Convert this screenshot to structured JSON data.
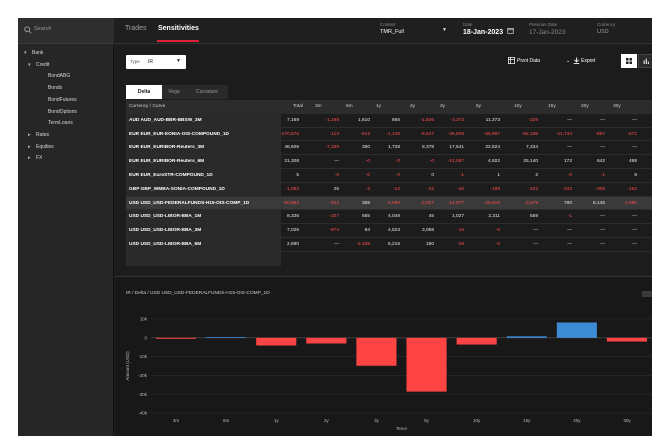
{
  "search": {
    "placeholder": "Search"
  },
  "sidebar": {
    "items": [
      {
        "label": "Bank",
        "arrow": "▾",
        "level": 0
      },
      {
        "label": "Credit",
        "arrow": "▾",
        "level": 1
      },
      {
        "label": "BondABG",
        "arrow": "",
        "level": 2
      },
      {
        "label": "Bonds",
        "arrow": "",
        "level": 2
      },
      {
        "label": "BondFutures",
        "arrow": "",
        "level": 2
      },
      {
        "label": "BondOptions",
        "arrow": "",
        "level": 2
      },
      {
        "label": "TermLoans",
        "arrow": "",
        "level": 2
      },
      {
        "label": "Rates",
        "arrow": "▸",
        "level": 1
      },
      {
        "label": "Equities",
        "arrow": "▸",
        "level": 1
      },
      {
        "label": "FX",
        "arrow": "▸",
        "level": 1
      }
    ]
  },
  "header": {
    "tabs": [
      "Trades",
      "Sensitivities"
    ],
    "context": {
      "caption": "Context",
      "value": "TMR_Full"
    },
    "date": {
      "caption": "Date",
      "value": "18-Jan-2023"
    },
    "previous_date": {
      "caption": "Previous Date",
      "value": "17-Jan-2023"
    },
    "currency": {
      "caption": "Currency",
      "value": "USD"
    }
  },
  "toolbar": {
    "type_label": "Type",
    "type_value": "IR",
    "pivot_label": "Pivot Data",
    "export_label": "Export"
  },
  "subtabs": [
    "Delta",
    "Vega",
    "Curvature"
  ],
  "table": {
    "columns": [
      "Currency / Curve",
      "Total",
      "3m",
      "6m",
      "1y",
      "2y",
      "3y",
      "5y",
      "10y",
      "15y",
      "20y",
      "30y"
    ],
    "rows": [
      {
        "name": "AUD AUD_AUD-BBR-BBSW_3M",
        "cells": [
          "7,169",
          "-1,189",
          "1,610",
          "665",
          "-1,836",
          "-3,373",
          "11,373",
          "-229",
          "—",
          "—",
          "—"
        ],
        "neg": [
          false,
          true,
          false,
          false,
          true,
          true,
          false,
          true,
          false,
          false,
          false
        ]
      },
      {
        "name": "EUR EUR_EUR-EONIA-OIS-COMPOUND_1D",
        "cells": [
          "-170,876",
          "-113",
          "-512",
          "-1,146",
          "-8,547",
          "-26,849",
          "-56,867",
          "-82,188",
          "-11,744",
          "-857",
          "-571"
        ],
        "neg": [
          true,
          true,
          true,
          true,
          true,
          true,
          true,
          true,
          true,
          true,
          true
        ]
      },
      {
        "name": "EUR EUR_EURIBOR-Reuters_3M",
        "cells": [
          "48,606",
          "-7,269",
          "390",
          "1,728",
          "8,378",
          "17,541",
          "22,824",
          "7,334",
          "—",
          "—",
          "—"
        ],
        "neg": [
          false,
          true,
          false,
          false,
          false,
          false,
          false,
          false,
          false,
          false,
          false
        ]
      },
      {
        "name": "EUR EUR_EURIBOR-Reuters_6M",
        "cells": [
          "21,308",
          "—",
          "-0",
          "-0",
          "-0",
          "-12,067",
          "4,922",
          "25,140",
          "172",
          "642",
          "498"
        ],
        "neg": [
          false,
          false,
          true,
          true,
          true,
          true,
          false,
          false,
          false,
          false,
          false
        ]
      },
      {
        "name": "EUR EUR_EuroSTR-COMPOUND_1D",
        "cells": [
          "5",
          "-0",
          "-0",
          "-0",
          "0",
          "-1",
          "1",
          "2",
          "-0",
          "-1",
          "6"
        ],
        "neg": [
          false,
          true,
          true,
          true,
          false,
          true,
          false,
          false,
          true,
          true,
          false
        ]
      },
      {
        "name": "GBP GBP_WMBA-SONIA-COMPOUND_1D",
        "cells": [
          "-1,083",
          "26",
          "-4",
          "-12",
          "-22",
          "-40",
          "-189",
          "-423",
          "-342",
          "-309",
          "-162"
        ],
        "neg": [
          true,
          false,
          true,
          true,
          true,
          true,
          true,
          true,
          true,
          true,
          true
        ]
      },
      {
        "name": "USD USD_USD-FEDERALFUNDS-H15-OIS-COMP_1D",
        "cells": [
          "-50,962",
          "-522",
          "365",
          "-4,090",
          "-3,027",
          "-14,877",
          "-28,618",
          "-3,579",
          "780",
          "8,145",
          "-1,980"
        ],
        "neg": [
          true,
          true,
          false,
          true,
          true,
          true,
          true,
          true,
          false,
          false,
          true
        ]
      },
      {
        "name": "USD USD_USD-LIBOR-BBA_1M",
        "cells": [
          "8,326",
          "-227",
          "565",
          "4,048",
          "45",
          "1,027",
          "2,311",
          "559",
          "-1",
          "—",
          "—"
        ],
        "neg": [
          false,
          true,
          false,
          false,
          false,
          false,
          false,
          false,
          true,
          false,
          false
        ]
      },
      {
        "name": "USD USD_USD-LIBOR-BBA_3M",
        "cells": [
          "7,026",
          "-874",
          "84",
          "4,523",
          "3,068",
          "-15",
          "-0",
          "—",
          "—",
          "—",
          "—"
        ],
        "neg": [
          false,
          true,
          false,
          false,
          false,
          true,
          true,
          false,
          false,
          false,
          false
        ]
      },
      {
        "name": "USD USD_USD-LIBOR-BBA_6M",
        "cells": [
          "2,690",
          "—",
          "-2,488",
          "5,216",
          "190",
          "-28",
          "-0",
          "—",
          "—",
          "—",
          "—"
        ],
        "neg": [
          false,
          false,
          true,
          false,
          false,
          true,
          true,
          false,
          false,
          false,
          false
        ]
      }
    ],
    "selected_row": 6
  },
  "chart_title": "IR / Delta / USD USD_USD-FEDERALFUNDS-H15-OIS-COMP_1D",
  "chart_data": {
    "type": "bar",
    "title": "IR / Delta / USD USD_USD-FEDERALFUNDS-H15-OIS-COMP_1D",
    "xlabel": "Tenor",
    "ylabel": "Amount (USD)",
    "categories": [
      "3m",
      "6m",
      "1y",
      "2y",
      "3y",
      "5y",
      "10y",
      "15y",
      "20y",
      "30y"
    ],
    "values": [
      -522,
      365,
      -4090,
      -3027,
      -14877,
      -28618,
      -3579,
      780,
      8145,
      -1980
    ],
    "ylim": [
      -40000,
      10000
    ],
    "yticks": [
      10000,
      0,
      -10000,
      -20000,
      -30000,
      -40000
    ],
    "ytick_labels": [
      "10k",
      "0",
      "-10k",
      "-20k",
      "-30k",
      "-40k"
    ],
    "colors": {
      "negative": "#ff4444",
      "positive": "#3d8bd4"
    },
    "grid": true,
    "legend": "none"
  },
  "colors": {
    "accent": "#e0213a",
    "negative": "#ff4d4d",
    "positive": "#3d8bd4"
  }
}
